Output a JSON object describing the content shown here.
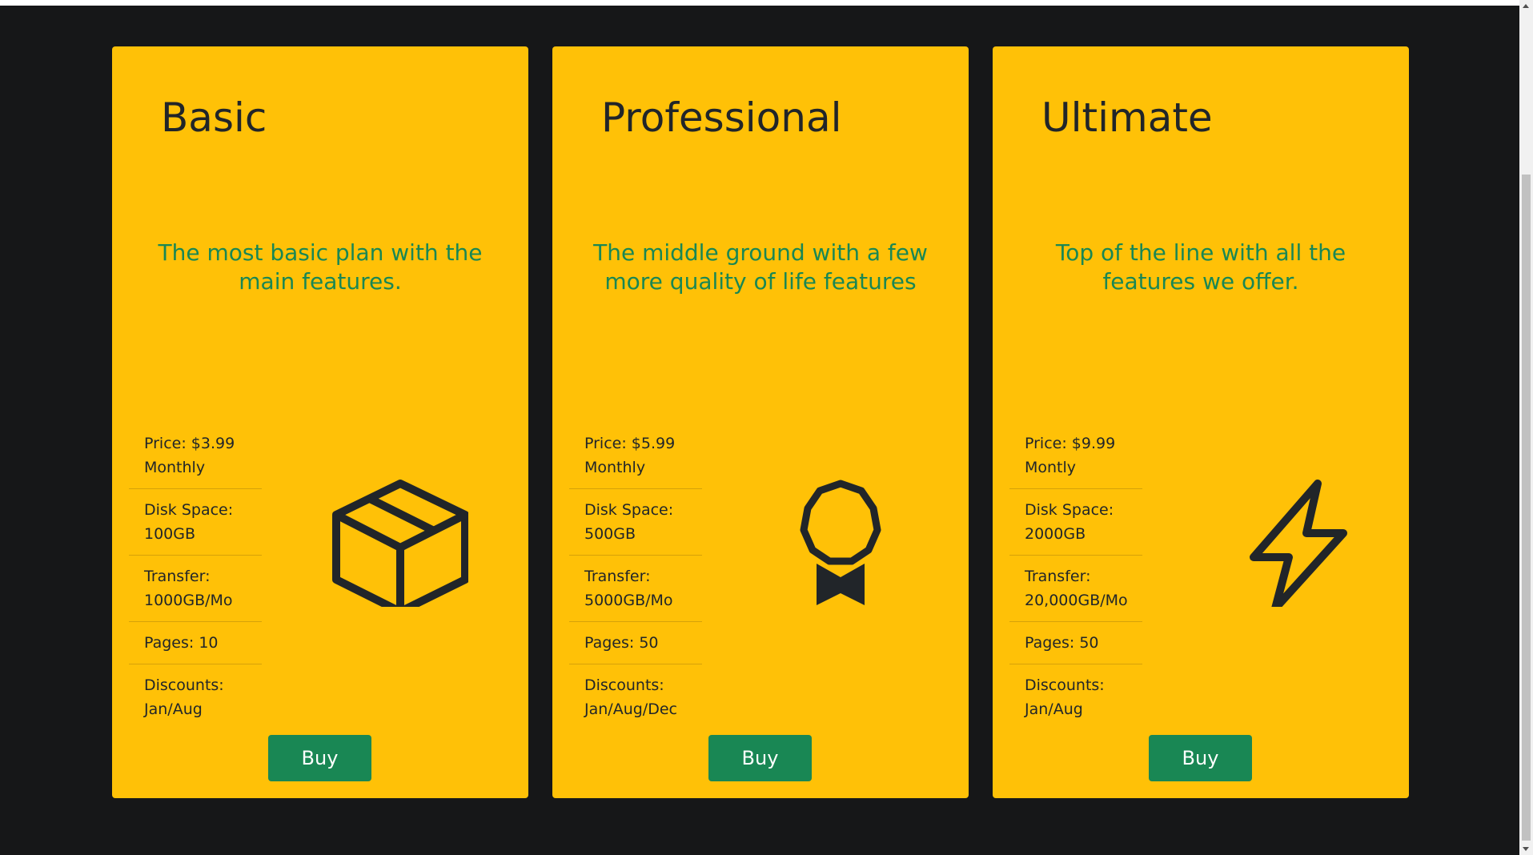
{
  "plans": [
    {
      "title": "Basic",
      "description": "The most basic plan with the main features.",
      "features": [
        "Price: $3.99 Monthly",
        "Disk Space: 100GB",
        "Transfer: 1000GB/Mo",
        "Pages: 10",
        "Discounts: Jan/Aug"
      ],
      "icon": "box-icon",
      "button_label": "Buy"
    },
    {
      "title": "Professional",
      "description": "The middle ground with a few more quality of life features",
      "features": [
        "Price: $5.99 Monthly",
        "Disk Space: 500GB",
        "Transfer: 5000GB/Mo",
        "Pages: 50",
        "Discounts: Jan/Aug/Dec"
      ],
      "icon": "award-icon",
      "button_label": "Buy"
    },
    {
      "title": "Ultimate",
      "description": "Top of the line with all the features we offer.",
      "features": [
        "Price: $9.99 Montly",
        "Disk Space: 2000GB",
        "Transfer: 20,000GB/Mo",
        "Pages: 50",
        "Discounts: Jan/Aug"
      ],
      "icon": "lightning-icon",
      "button_label": "Buy"
    }
  ],
  "colors": {
    "background": "#161718",
    "card": "#ffc107",
    "accent": "#198754",
    "text": "#212529"
  }
}
